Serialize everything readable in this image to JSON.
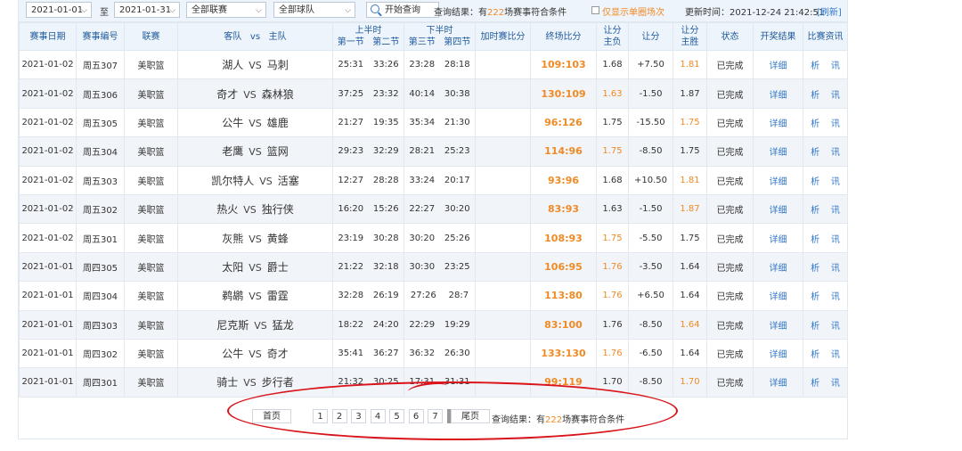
{
  "filter": {
    "start_date": "2021-01-01",
    "to_label": "至",
    "end_date": "2021-01-31",
    "league": "全部联赛",
    "team": "全部球队",
    "query_button": "开始查询",
    "result_prefix": "查询结果：有",
    "result_count": "222",
    "result_suffix": "场赛事符合条件",
    "single_checkbox_label": "仅显示单圈场次",
    "update_label": "更新时间：2021-12-24 21:42:51",
    "refresh_label": "[刷新]"
  },
  "headers": {
    "date": "赛事日期",
    "number": "赛事编号",
    "league": "联赛",
    "guest": "客队",
    "vs": "vs",
    "home": "主队",
    "first_half": "上半时",
    "q1": "第一节",
    "q2": "第二节",
    "second_half": "下半时",
    "q3": "第三节",
    "q4": "第四节",
    "ot": "加时赛比分",
    "final": "终场比分",
    "spread_result_1": "让分",
    "spread_result_2": "主负",
    "spread": "让分",
    "spread_win_1": "让分",
    "spread_win_2": "主胜",
    "status": "状态",
    "lottery": "开奖结果",
    "info": "比赛资讯"
  },
  "rows": [
    {
      "date": "2021-01-02",
      "num": "周五307",
      "league": "美职篮",
      "away": "湖人",
      "vs": "VS",
      "home": "马刺",
      "q1": "25:31",
      "q2": "33:26",
      "q3": "23:28",
      "q4": "28:18",
      "ot": "",
      "final": "109:103",
      "lose": "1.68",
      "spread": "+7.50",
      "win": "1.81",
      "hl": "win",
      "status": "已完成",
      "detail": "详细",
      "an": "析",
      "xun": "讯"
    },
    {
      "date": "2021-01-02",
      "num": "周五306",
      "league": "美职篮",
      "away": "奇才",
      "vs": "VS",
      "home": "森林狼",
      "q1": "37:25",
      "q2": "23:32",
      "q3": "40:14",
      "q4": "30:38",
      "ot": "",
      "final": "130:109",
      "lose": "1.63",
      "spread": "-1.50",
      "win": "1.87",
      "hl": "lose",
      "status": "已完成",
      "detail": "详细",
      "an": "析",
      "xun": "讯"
    },
    {
      "date": "2021-01-02",
      "num": "周五305",
      "league": "美职篮",
      "away": "公牛",
      "vs": "VS",
      "home": "雄鹿",
      "q1": "21:27",
      "q2": "19:35",
      "q3": "35:34",
      "q4": "21:30",
      "ot": "",
      "final": "96:126",
      "lose": "1.75",
      "spread": "-15.50",
      "win": "1.75",
      "hl": "win",
      "status": "已完成",
      "detail": "详细",
      "an": "析",
      "xun": "讯"
    },
    {
      "date": "2021-01-02",
      "num": "周五304",
      "league": "美职篮",
      "away": "老鹰",
      "vs": "VS",
      "home": "篮网",
      "q1": "29:23",
      "q2": "32:29",
      "q3": "28:21",
      "q4": "25:23",
      "ot": "",
      "final": "114:96",
      "lose": "1.75",
      "spread": "-8.50",
      "win": "1.75",
      "hl": "lose",
      "status": "已完成",
      "detail": "详细",
      "an": "析",
      "xun": "讯"
    },
    {
      "date": "2021-01-02",
      "num": "周五303",
      "league": "美职篮",
      "away": "凯尔特人",
      "vs": "VS",
      "home": "活塞",
      "q1": "12:27",
      "q2": "28:28",
      "q3": "33:24",
      "q4": "20:17",
      "ot": "",
      "final": "93:96",
      "lose": "1.68",
      "spread": "+10.50",
      "win": "1.81",
      "hl": "win",
      "status": "已完成",
      "detail": "详细",
      "an": "析",
      "xun": "讯"
    },
    {
      "date": "2021-01-02",
      "num": "周五302",
      "league": "美职篮",
      "away": "热火",
      "vs": "VS",
      "home": "独行侠",
      "q1": "16:20",
      "q2": "15:26",
      "q3": "22:27",
      "q4": "30:20",
      "ot": "",
      "final": "83:93",
      "lose": "1.63",
      "spread": "-1.50",
      "win": "1.87",
      "hl": "win",
      "status": "已完成",
      "detail": "详细",
      "an": "析",
      "xun": "讯"
    },
    {
      "date": "2021-01-02",
      "num": "周五301",
      "league": "美职篮",
      "away": "灰熊",
      "vs": "VS",
      "home": "黄蜂",
      "q1": "23:19",
      "q2": "30:28",
      "q3": "30:20",
      "q4": "25:26",
      "ot": "",
      "final": "108:93",
      "lose": "1.75",
      "spread": "-5.50",
      "win": "1.75",
      "hl": "lose",
      "status": "已完成",
      "detail": "详细",
      "an": "析",
      "xun": "讯"
    },
    {
      "date": "2021-01-01",
      "num": "周四305",
      "league": "美职篮",
      "away": "太阳",
      "vs": "VS",
      "home": "爵士",
      "q1": "21:22",
      "q2": "32:18",
      "q3": "30:30",
      "q4": "23:25",
      "ot": "",
      "final": "106:95",
      "lose": "1.76",
      "spread": "-3.50",
      "win": "1.64",
      "hl": "lose",
      "status": "已完成",
      "detail": "详细",
      "an": "析",
      "xun": "讯"
    },
    {
      "date": "2021-01-01",
      "num": "周四304",
      "league": "美职篮",
      "away": "鹈鹕",
      "vs": "VS",
      "home": "雷霆",
      "q1": "32:28",
      "q2": "26:19",
      "q3": "27:26",
      "q4": "28:7",
      "ot": "",
      "final": "113:80",
      "lose": "1.76",
      "spread": "+6.50",
      "win": "1.64",
      "hl": "lose",
      "status": "已完成",
      "detail": "详细",
      "an": "析",
      "xun": "讯"
    },
    {
      "date": "2021-01-01",
      "num": "周四303",
      "league": "美职篮",
      "away": "尼克斯",
      "vs": "VS",
      "home": "猛龙",
      "q1": "18:22",
      "q2": "24:20",
      "q3": "22:29",
      "q4": "19:29",
      "ot": "",
      "final": "83:100",
      "lose": "1.76",
      "spread": "-8.50",
      "win": "1.64",
      "hl": "win",
      "status": "已完成",
      "detail": "详细",
      "an": "析",
      "xun": "讯"
    },
    {
      "date": "2021-01-01",
      "num": "周四302",
      "league": "美职篮",
      "away": "公牛",
      "vs": "VS",
      "home": "奇才",
      "q1": "35:41",
      "q2": "36:27",
      "q3": "36:32",
      "q4": "26:30",
      "ot": "",
      "final": "133:130",
      "lose": "1.76",
      "spread": "-6.50",
      "win": "1.64",
      "hl": "lose",
      "status": "已完成",
      "detail": "详细",
      "an": "析",
      "xun": "讯"
    },
    {
      "date": "2021-01-01",
      "num": "周四301",
      "league": "美职篮",
      "away": "骑士",
      "vs": "VS",
      "home": "步行者",
      "q1": "21:32",
      "q2": "30:25",
      "q3": "17:31",
      "q4": "31:31",
      "ot": "",
      "final": "99:119",
      "lose": "1.70",
      "spread": "-8.50",
      "win": "1.70",
      "hl": "win",
      "status": "已完成",
      "detail": "详细",
      "an": "析",
      "xun": "讯"
    }
  ],
  "pager": {
    "first": "首页",
    "pages": [
      "1",
      "2",
      "3",
      "4",
      "5",
      "6",
      "7",
      "8"
    ],
    "current": "8",
    "last": "尾页",
    "result_prefix": "查询结果：有",
    "result_count": "222",
    "result_suffix": "场赛事符合条件"
  },
  "colors": {
    "accent": "#f08a24",
    "link": "#2f76c9",
    "annotation": "#d9141a"
  }
}
